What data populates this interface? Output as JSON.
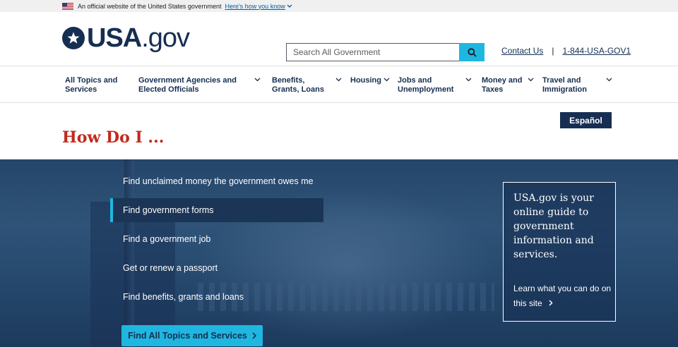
{
  "banner": {
    "official_text": "An official website of the United States government",
    "howto_link": "Here's how you know"
  },
  "header": {
    "logo_main": "USA",
    "logo_suffix": ".gov",
    "search": {
      "placeholder": "Search All Government"
    },
    "contact_link": "Contact Us",
    "phone_link": "1-844-USA-GOV1"
  },
  "nav": {
    "items": [
      {
        "label": "All Topics and Services",
        "has_menu": false
      },
      {
        "label": "Government Agencies and Elected Officials",
        "has_menu": true
      },
      {
        "label": "Benefits, Grants, Loans",
        "has_menu": true
      },
      {
        "label": "Housing",
        "has_menu": true
      },
      {
        "label": "Jobs and Unemployment",
        "has_menu": true
      },
      {
        "label": "Money and Taxes",
        "has_menu": true
      },
      {
        "label": "Travel and Immigration",
        "has_menu": true
      }
    ]
  },
  "page": {
    "language_button": "Español",
    "title": "How Do I ..."
  },
  "hero": {
    "links": [
      {
        "label": "Find unclaimed money the government owes me",
        "active": false
      },
      {
        "label": "Find government forms",
        "active": true
      },
      {
        "label": "Find a government job",
        "active": false
      },
      {
        "label": "Get or renew a passport",
        "active": false
      },
      {
        "label": "Find benefits, grants and loans",
        "active": false
      }
    ],
    "cta_label": "Find All Topics and Services",
    "infobox": {
      "headline": "USA.gov is your online guide to government information and services.",
      "learn_more": "Learn what you can do on this site"
    }
  },
  "colors": {
    "navy": "#162e51",
    "cyan": "#1fb7e0",
    "red_title": "#c3291c",
    "link_blue": "#005ea2"
  }
}
